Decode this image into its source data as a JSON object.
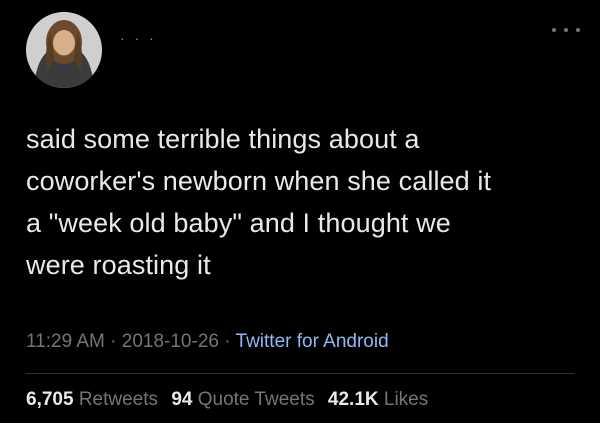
{
  "header": {
    "redacted_name": "· · ·",
    "more_icon": "more-horizontal-icon"
  },
  "tweet": {
    "lines": [
      "said some terrible things about a",
      "coworker's newborn when she called it",
      "a \"week old baby\" and I thought we",
      "were roasting it"
    ]
  },
  "meta": {
    "time": "11:29 AM",
    "sep1": " · ",
    "date": "2018-10-26",
    "sep2": " · ",
    "source": "Twitter for Android"
  },
  "stats": {
    "retweets_count": "6,705",
    "retweets_label": "Retweets",
    "quotes_count": "94",
    "quotes_label": "Quote Tweets",
    "likes_count": "42.1K",
    "likes_label": "Likes"
  },
  "colors": {
    "background": "#000000",
    "text": "#e7e9ea",
    "muted": "#71767b",
    "link": "#8fb8f4"
  }
}
